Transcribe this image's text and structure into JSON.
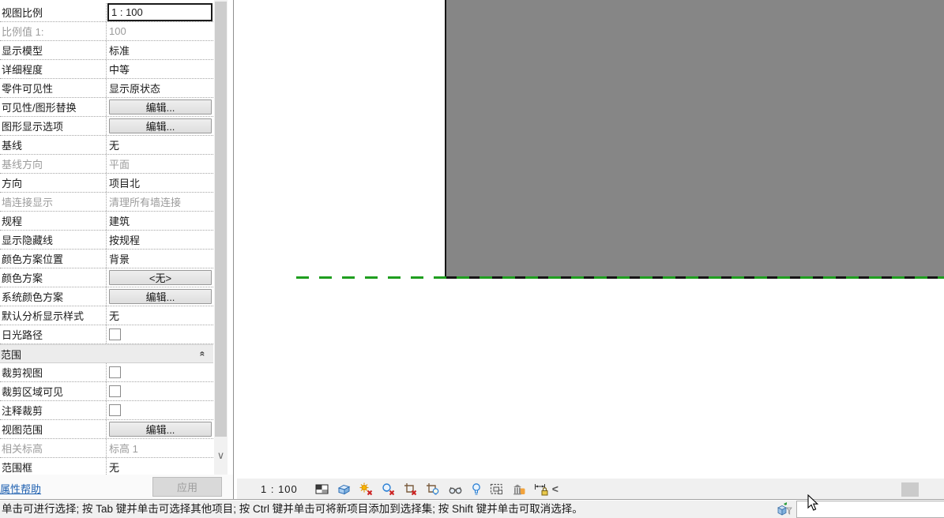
{
  "colors": {
    "link_blue": "#1c5fb0",
    "canvas_gray": "#868686",
    "dash_green": "#1f9e1f",
    "selection_border": "#1a1a1a"
  },
  "properties_panel": {
    "rows": [
      {
        "label": "视图比例",
        "value": "1 : 100",
        "type": "input"
      },
      {
        "label": "比例值 1:",
        "value": "100",
        "type": "text",
        "disabled": true
      },
      {
        "label": "显示模型",
        "value": "标准",
        "type": "text"
      },
      {
        "label": "详细程度",
        "value": "中等",
        "type": "text"
      },
      {
        "label": "零件可见性",
        "value": "显示原状态",
        "type": "text"
      },
      {
        "label": "可见性/图形替换",
        "value": "编辑...",
        "type": "button"
      },
      {
        "label": "图形显示选项",
        "value": "编辑...",
        "type": "button"
      },
      {
        "label": "基线",
        "value": "无",
        "type": "text"
      },
      {
        "label": "基线方向",
        "value": "平面",
        "type": "text",
        "disabled": true
      },
      {
        "label": "方向",
        "value": "项目北",
        "type": "text"
      },
      {
        "label": "墙连接显示",
        "value": "清理所有墙连接",
        "type": "text",
        "disabled": true
      },
      {
        "label": "规程",
        "value": "建筑",
        "type": "text"
      },
      {
        "label": "显示隐藏线",
        "value": "按规程",
        "type": "text"
      },
      {
        "label": "颜色方案位置",
        "value": "背景",
        "type": "text"
      },
      {
        "label": "颜色方案",
        "value": "<无>",
        "type": "button"
      },
      {
        "label": "系统颜色方案",
        "value": "编辑...",
        "type": "button"
      },
      {
        "label": "默认分析显示样式",
        "value": "无",
        "type": "text"
      },
      {
        "label": "日光路径",
        "value": "",
        "type": "checkbox",
        "checked": false
      },
      {
        "label": "范围",
        "value": "",
        "type": "section"
      },
      {
        "label": "裁剪视图",
        "value": "",
        "type": "checkbox",
        "checked": false
      },
      {
        "label": "裁剪区域可见",
        "value": "",
        "type": "checkbox",
        "checked": false
      },
      {
        "label": "注释裁剪",
        "value": "",
        "type": "checkbox",
        "checked": false
      },
      {
        "label": "视图范围",
        "value": "编辑...",
        "type": "button"
      },
      {
        "label": "相关标高",
        "value": "标高 1",
        "type": "text",
        "disabled": true
      },
      {
        "label": "范围框",
        "value": "无",
        "type": "text"
      }
    ],
    "footer": {
      "help_link": "属性帮助",
      "apply_label": "应用"
    }
  },
  "view_control_bar": {
    "scale_label": "1 : 100",
    "icons": [
      "scale-icon",
      "visual-style-icon",
      "sun-path-icon",
      "shadows-icon",
      "crop-view-icon",
      "show-crop-region-icon",
      "temporary-hide-isolate-icon",
      "reveal-hidden-elements-icon",
      "temporary-view-properties-icon",
      "displaced-elements-icon",
      "constraints-icon"
    ],
    "collapse_label": "<"
  },
  "status_bar": {
    "message": "单击可进行选择; 按 Tab 键并单击可选择其他项目; 按 Ctrl 键并单击可将新项目添加到选择集; 按 Shift 键并单击可取消选择。",
    "filter_icon": "selection-filter-icon"
  }
}
